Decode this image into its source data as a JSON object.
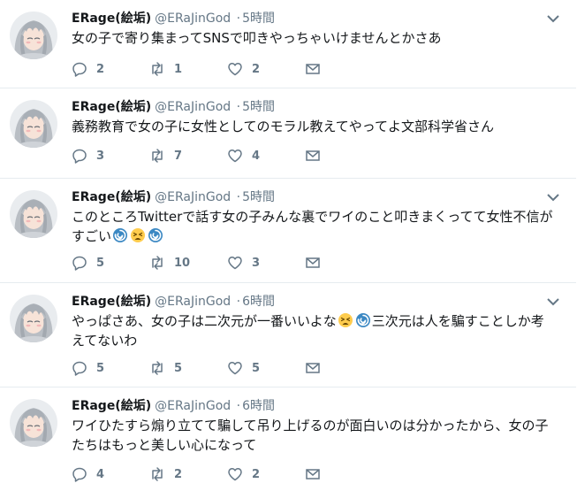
{
  "tweets": [
    {
      "name": "ERage(絵垢)",
      "handle": "@ERaJinGod",
      "dot": "·",
      "time": "5時間",
      "text": [
        "女の子で寄り集まってSNSで叩きやっちゃいけませんとかさあ"
      ],
      "reply_count": "2",
      "retweet_count": "1",
      "like_count": "2"
    },
    {
      "name": "ERage(絵垢)",
      "handle": "@ERaJinGod",
      "dot": "·",
      "time": "5時間",
      "text": [
        "義務教育で女の子に女性としてのモラル教えてやってよ文部科学省さん"
      ],
      "reply_count": "3",
      "retweet_count": "7",
      "like_count": "4"
    },
    {
      "name": "ERage(絵垢)",
      "handle": "@ERaJinGod",
      "dot": "·",
      "time": "5時間",
      "text": [
        "このところTwitterで話す女の子みんな裏でワイのこと叩きまくってて女性不信が",
        "すごい"
      ],
      "reply_count": "5",
      "retweet_count": "10",
      "like_count": "3"
    },
    {
      "name": "ERage(絵垢)",
      "handle": "@ERaJinGod",
      "dot": "·",
      "time": "6時間",
      "text": [
        "やっぱさあ、女の子は二次元が一番いいよな",
        "三次元は人を騙すことしか考",
        "えてないわ"
      ],
      "reply_count": "5",
      "retweet_count": "5",
      "like_count": "5"
    },
    {
      "name": "ERage(絵垢)",
      "handle": "@ERaJinGod",
      "dot": "·",
      "time": "6時間",
      "text": [
        "ワイひたすら煽り立てて騙して吊り上げるのが面白いのは分かったから、女の子",
        "たちはもっと美しい心になって"
      ],
      "reply_count": "4",
      "retweet_count": "2",
      "like_count": "2"
    }
  ],
  "icons": {
    "reply": "reply-icon",
    "retweet": "retweet-icon",
    "like": "heart-icon",
    "dm": "envelope-icon",
    "caret": "chevron-down-icon",
    "emoji_dizzy": "cyclone-emoji",
    "emoji_tired": "tired-face-emoji"
  },
  "colors": {
    "text": "#14171a",
    "secondary": "#657786",
    "divider": "#e6ecf0"
  }
}
